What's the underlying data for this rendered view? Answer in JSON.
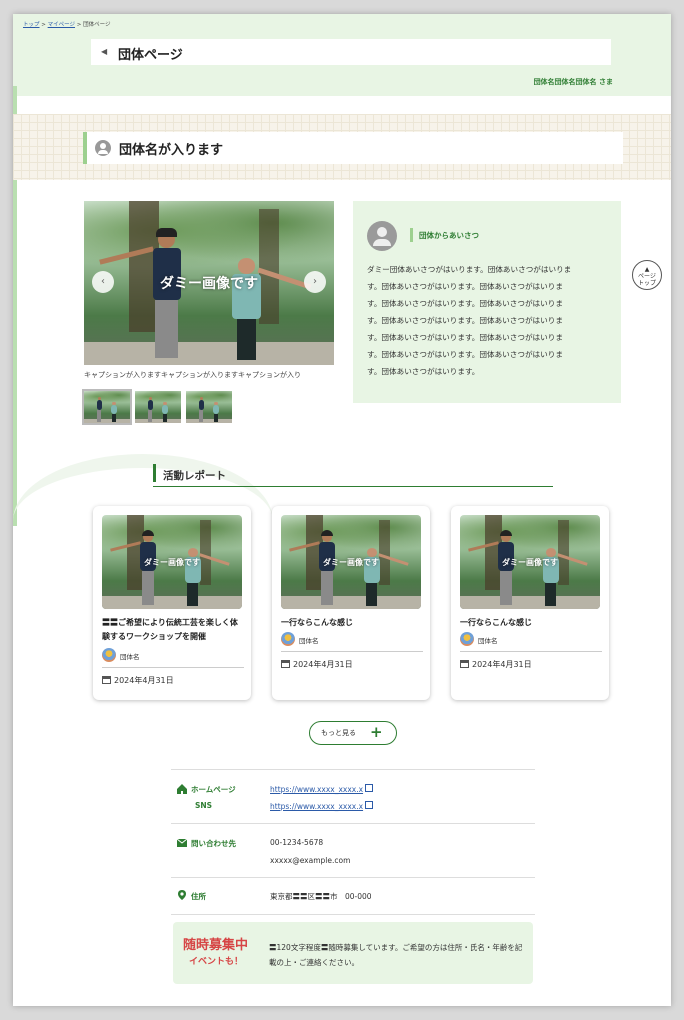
{
  "breadcrumb": {
    "top": "トップ",
    "sep": ">",
    "mypage": "マイページ",
    "current": "団体ページ"
  },
  "header": {
    "title": "団体ページ",
    "user": "団体名団体名団体名 さま"
  },
  "group": {
    "name": "団体名が入ります"
  },
  "slider": {
    "dummy": "ダミー画像です",
    "caption": "キャプションが入りますキャプションが入りますキャプションが入り",
    "prev": "‹",
    "next": "›"
  },
  "greeting": {
    "heading": "団体からあいさつ",
    "lines": [
      "ダミー団体あいさつがはいります。団体あいさつがはいりま",
      "す。団体あいさつがはいります。団体あいさつがはいりま",
      "す。団体あいさつがはいります。団体あいさつがはいりま",
      "す。団体あいさつがはいります。団体あいさつがはいりま",
      "す。団体あいさつがはいります。団体あいさつがはいりま",
      "す。団体あいさつがはいります。団体あいさつがはいりま",
      "す。団体あいさつがはいります。"
    ]
  },
  "pagetop": {
    "arrow": "▲",
    "l1": "ページ",
    "l2": "トップ"
  },
  "activity": {
    "title": "活動レポート",
    "cards": [
      {
        "title": "〓〓ご希望により伝統工芸を楽しく体験するワークショップを開催",
        "org": "団体名",
        "date": "2024年4月31日"
      },
      {
        "title": "一行ならこんな感じ",
        "org": "団体名",
        "date": "2024年4月31日"
      },
      {
        "title": "一行ならこんな感じ",
        "org": "団体名",
        "date": "2024年4月31日"
      }
    ],
    "more": "もっと見る",
    "more_icon": "+"
  },
  "info": {
    "homepage_label": "ホームページ",
    "homepage_url": "https://www.xxxx_xxxx.x",
    "sns_label": "SNS",
    "sns_url": "https://www.xxxx_xxxx.x",
    "contact_label": "問い合わせ先",
    "phone": "00-1234-5678",
    "email": "xxxxx@example.com",
    "address_label": "住所",
    "address": "東京都〓〓区〓〓市　00-000"
  },
  "recruit": {
    "badge1": "随時募集中",
    "badge2": "イベントも！",
    "text": "〓120文字程度〓随時募集しています。ご希望の方は住所・氏名・年齢を記載の上・ご連絡ください。"
  },
  "colors": {
    "accent": "#2e7d32",
    "light_green": "#e8f5e4",
    "link": "#2b5aa8",
    "recruit_red": "#d64545"
  }
}
